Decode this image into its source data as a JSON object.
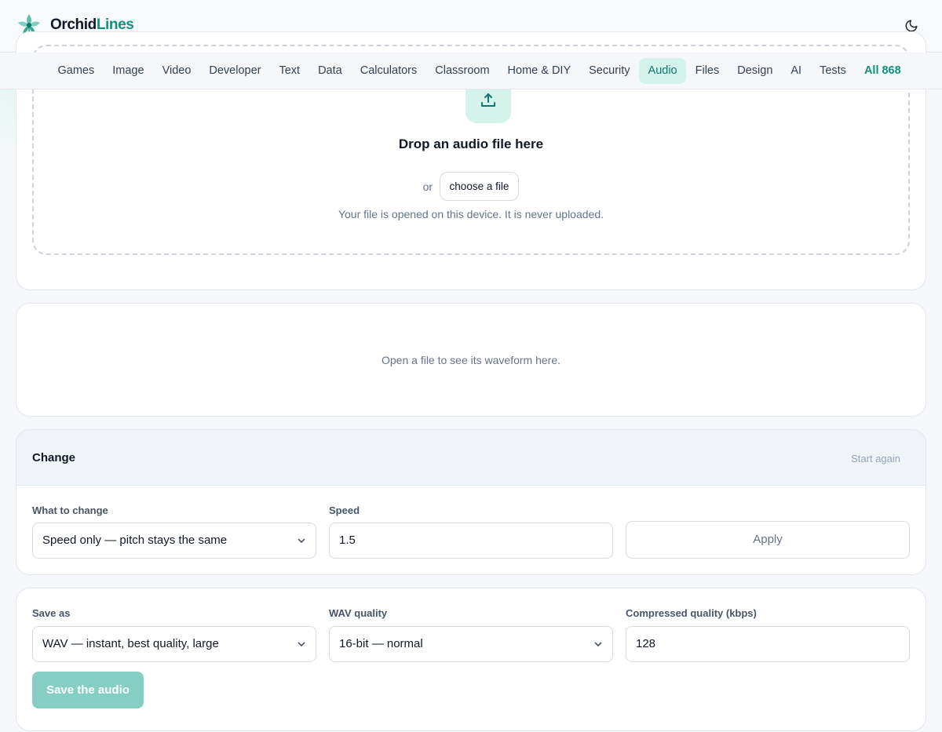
{
  "brand": {
    "name_part1": "Orchid",
    "name_part2": "Lines"
  },
  "header": {
    "theme_toggle_icon": "moon-icon"
  },
  "nav": {
    "items": [
      {
        "label": "Games"
      },
      {
        "label": "Image"
      },
      {
        "label": "Video"
      },
      {
        "label": "Developer"
      },
      {
        "label": "Text"
      },
      {
        "label": "Data"
      },
      {
        "label": "Calculators"
      },
      {
        "label": "Classroom"
      },
      {
        "label": "Home & DIY"
      },
      {
        "label": "Security"
      },
      {
        "label": "Audio"
      },
      {
        "label": "Files"
      },
      {
        "label": "Design"
      },
      {
        "label": "AI"
      },
      {
        "label": "Tests"
      },
      {
        "label": "All 868"
      }
    ],
    "active": "Audio"
  },
  "dropzone": {
    "icon": "upload-icon",
    "title": "Drop an audio file here",
    "or_text": "or",
    "choose_label": "choose a file",
    "note": "Your file is opened on this device. It is never uploaded."
  },
  "waveform": {
    "placeholder": "Open a file to see its waveform here."
  },
  "change": {
    "title": "Change",
    "start_again": "Start again",
    "what_label": "What to change",
    "what_value": "Speed only — pitch stays the same",
    "speed_label": "Speed",
    "speed_value": "1.5",
    "apply_label": "Apply"
  },
  "save": {
    "save_as_label": "Save as",
    "save_as_value": "WAV — instant, best quality, large",
    "wav_quality_label": "WAV quality",
    "wav_quality_value": "16-bit — normal",
    "compressed_label": "Compressed quality (kbps)",
    "compressed_value": "128",
    "save_button": "Save the audio"
  },
  "colors": {
    "accent": "#11907b",
    "accent_light": "#d4f3ea",
    "save_button": "#86cec2"
  }
}
